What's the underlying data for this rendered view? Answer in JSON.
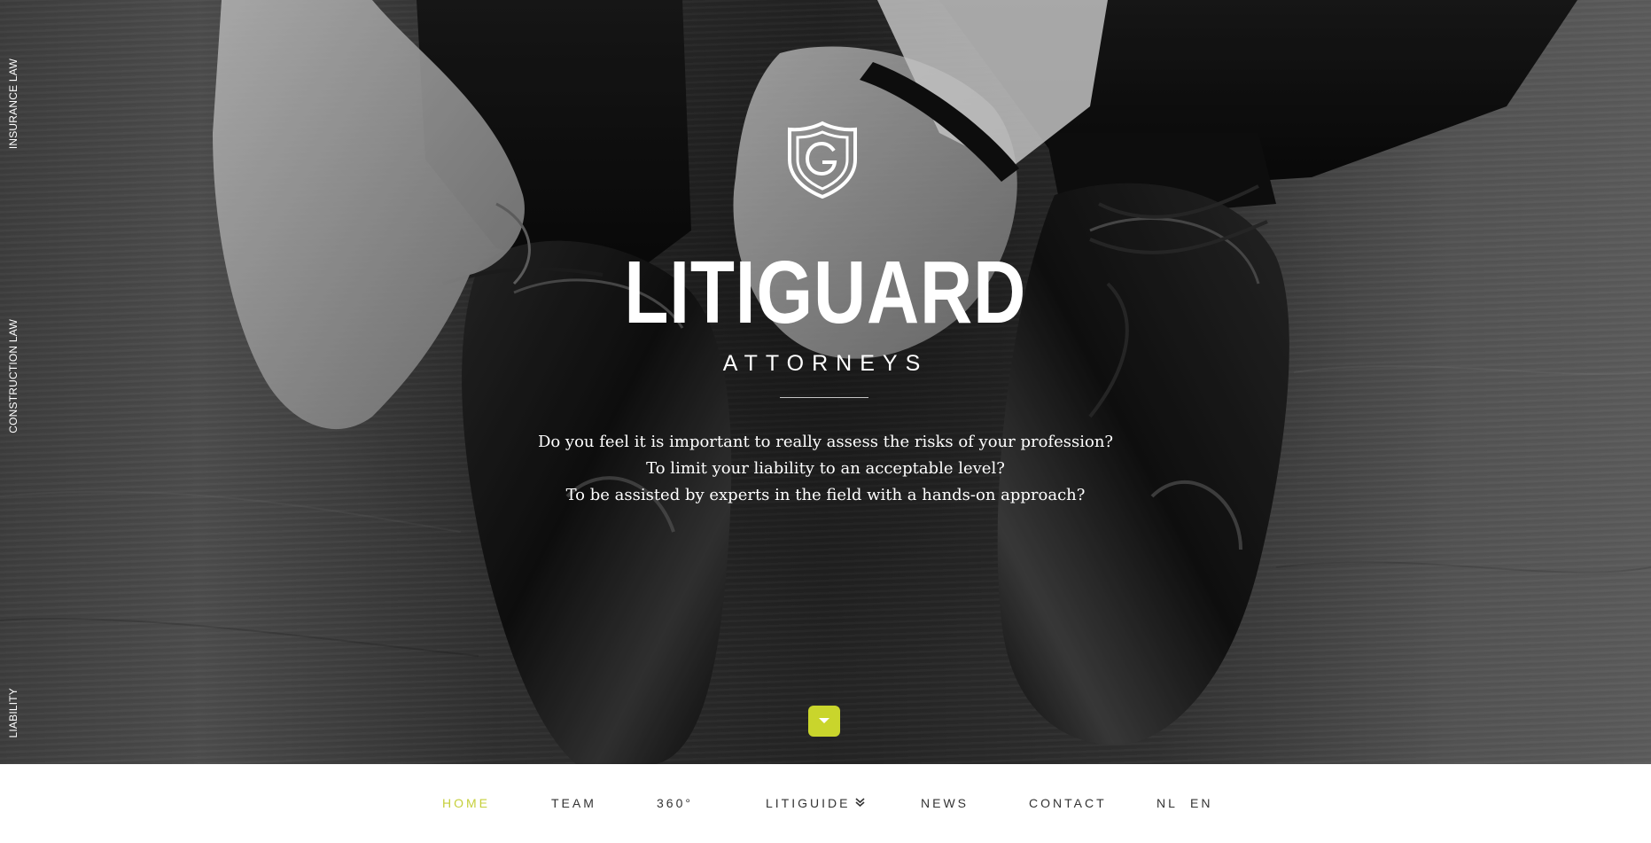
{
  "sidebar": {
    "items": [
      {
        "label": "INSURANCE LAW"
      },
      {
        "label": "CONSTRUCTION LAW"
      },
      {
        "label": "LIABILITY"
      }
    ]
  },
  "hero": {
    "logo_icon": "shield-g-logo-icon",
    "title": "LITIGUARD",
    "subtitle": "ATTORNEYS",
    "intro_lines": [
      "Do you feel it is important to really assess the risks of your profession?",
      "To limit your liability to an acceptable level?",
      "To be assisted by experts in the field with a hands-on approach?"
    ],
    "scroll_icon": "caret-down-icon"
  },
  "nav": {
    "items": [
      {
        "label": "HOME",
        "active": true
      },
      {
        "label": "TEAM"
      },
      {
        "label": "360°"
      },
      {
        "label": "LITIGUIDE",
        "dropdown_icon": "double-chevron-down-icon"
      },
      {
        "label": "NEWS"
      },
      {
        "label": "CONTACT"
      }
    ],
    "languages": [
      "NL",
      "EN"
    ]
  },
  "colors": {
    "accent": "#c9d52c",
    "nav_text": "#333333",
    "hero_text": "#ffffff"
  }
}
